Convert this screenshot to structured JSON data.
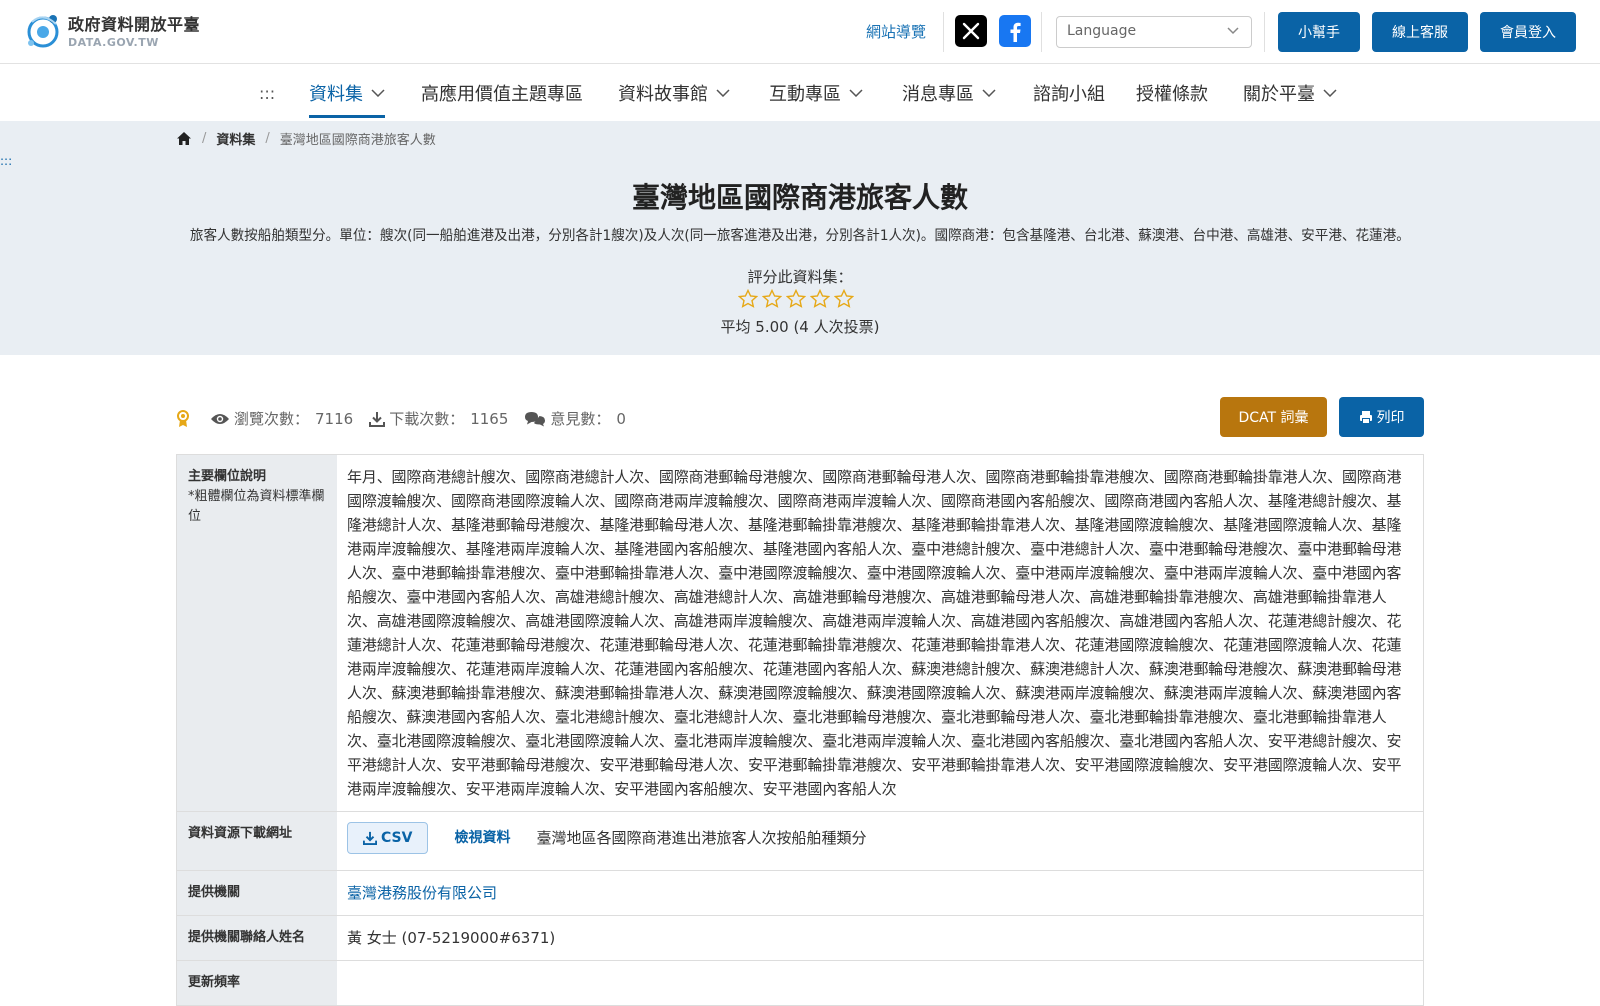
{
  "header": {
    "logo_title": "政府資料開放平臺",
    "logo_subtitle": "DATA.GOV.TW",
    "sitemap": "網站導覽",
    "language_placeholder": "Language",
    "helper_button": "小幫手",
    "support_button": "線上客服",
    "login_button": "會員登入",
    "accent_color": "#0a63a6"
  },
  "nav": {
    "access_key": ":::",
    "items": [
      {
        "label": "資料集",
        "dropdown": true
      },
      {
        "label": "高應用價值主題專區",
        "dropdown": false
      },
      {
        "label": "資料故事館",
        "dropdown": true
      },
      {
        "label": "互動專區",
        "dropdown": true
      },
      {
        "label": "消息專區",
        "dropdown": true
      },
      {
        "label": "諮詢小組",
        "dropdown": false
      },
      {
        "label": "授權條款",
        "dropdown": false
      },
      {
        "label": "關於平臺",
        "dropdown": true
      }
    ]
  },
  "breadcrumb": {
    "home_icon": "home-icon",
    "section": "資料集",
    "current": "臺灣地區國際商港旅客人數"
  },
  "side_access_key": ":::",
  "dataset": {
    "title": "臺灣地區國際商港旅客人數",
    "description": "旅客人數按船舶類型分。單位：艘次(同一船舶進港及出港，分別各計1艘次)及人次(同一旅客進港及出港，分別各計1人次)。國際商港：包含基隆港、台北港、蘇澳港、台中港、高雄港、安平港、花蓮港。",
    "rate_label": "評分此資料集：",
    "star_count": 5,
    "average_text": "平均 5.00 (4 人次投票)"
  },
  "stats": {
    "views_label": "瀏覽次數：",
    "views": "7116",
    "downloads_label": "下載次數：",
    "downloads": "1165",
    "comments_label": "意見數：",
    "comments": "0",
    "dcat_button": "DCAT 詞彙",
    "print_button": "列印"
  },
  "table": {
    "fields_label": "主要欄位說明",
    "fields_note": "*粗體欄位為資料標準欄位",
    "fields_value": "年月、國際商港總計艘次、國際商港總計人次、國際商港郵輪母港艘次、國際商港郵輪母港人次、國際商港郵輪掛靠港艘次、國際商港郵輪掛靠港人次、國際商港國際渡輪艘次、國際商港國際渡輪人次、國際商港兩岸渡輪艘次、國際商港兩岸渡輪人次、國際商港國內客船艘次、國際商港國內客船人次、基隆港總計艘次、基隆港總計人次、基隆港郵輪母港艘次、基隆港郵輪母港人次、基隆港郵輪掛靠港艘次、基隆港郵輪掛靠港人次、基隆港國際渡輪艘次、基隆港國際渡輪人次、基隆港兩岸渡輪艘次、基隆港兩岸渡輪人次、基隆港國內客船艘次、基隆港國內客船人次、臺中港總計艘次、臺中港總計人次、臺中港郵輪母港艘次、臺中港郵輪母港人次、臺中港郵輪掛靠港艘次、臺中港郵輪掛靠港人次、臺中港國際渡輪艘次、臺中港國際渡輪人次、臺中港兩岸渡輪艘次、臺中港兩岸渡輪人次、臺中港國內客船艘次、臺中港國內客船人次、高雄港總計艘次、高雄港總計人次、高雄港郵輪母港艘次、高雄港郵輪母港人次、高雄港郵輪掛靠港艘次、高雄港郵輪掛靠港人次、高雄港國際渡輪艘次、高雄港國際渡輪人次、高雄港兩岸渡輪艘次、高雄港兩岸渡輪人次、高雄港國內客船艘次、高雄港國內客船人次、花蓮港總計艘次、花蓮港總計人次、花蓮港郵輪母港艘次、花蓮港郵輪母港人次、花蓮港郵輪掛靠港艘次、花蓮港郵輪掛靠港人次、花蓮港國際渡輪艘次、花蓮港國際渡輪人次、花蓮港兩岸渡輪艘次、花蓮港兩岸渡輪人次、花蓮港國內客船艘次、花蓮港國內客船人次、蘇澳港總計艘次、蘇澳港總計人次、蘇澳港郵輪母港艘次、蘇澳港郵輪母港人次、蘇澳港郵輪掛靠港艘次、蘇澳港郵輪掛靠港人次、蘇澳港國際渡輪艘次、蘇澳港國際渡輪人次、蘇澳港兩岸渡輪艘次、蘇澳港兩岸渡輪人次、蘇澳港國內客船艘次、蘇澳港國內客船人次、臺北港總計艘次、臺北港總計人次、臺北港郵輪母港艘次、臺北港郵輪母港人次、臺北港郵輪掛靠港艘次、臺北港郵輪掛靠港人次、臺北港國際渡輪艘次、臺北港國際渡輪人次、臺北港兩岸渡輪艘次、臺北港兩岸渡輪人次、臺北港國內客船艘次、臺北港國內客船人次、安平港總計艘次、安平港總計人次、安平港郵輪母港艘次、安平港郵輪母港人次、安平港郵輪掛靠港艘次、安平港郵輪掛靠港人次、安平港國際渡輪艘次、安平港國際渡輪人次、安平港兩岸渡輪艘次、安平港兩岸渡輪人次、安平港國內客船艘次、安平港國內客船人次",
    "download_label": "資料資源下載網址",
    "csv_button": "CSV",
    "view_data": "檢視資料",
    "resource_name": "臺灣地區各國際商港進出港旅客人次按船舶種類分",
    "provider_label": "提供機關",
    "provider_value": "臺灣港務股份有限公司",
    "contact_label": "提供機關聯絡人姓名",
    "contact_value": "黃 女士 (07-5219000#6371)",
    "frequency_label": "更新頻率"
  }
}
